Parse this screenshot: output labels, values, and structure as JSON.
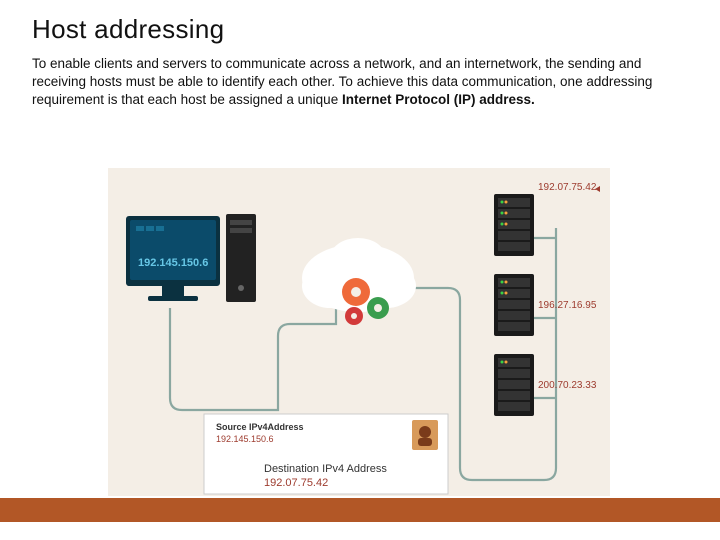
{
  "title": "Host addressing",
  "paragraph_a": "To enable clients and servers to communicate across a network, and an internetwork, the sending and receiving hosts must be able to identify each other. To achieve this data communication, one addressing requirement is that each host be assigned a unique ",
  "paragraph_b": "Internet Protocol (IP) address.",
  "diagram": {
    "client_ip": "192.145.150.6",
    "servers": [
      {
        "ip": "192.07.75.42"
      },
      {
        "ip": "196.27.16.95"
      },
      {
        "ip": "200.70.23.33"
      }
    ],
    "source_label": "Source IPv4Address",
    "source_value": "192.145.150.6",
    "dest_label": "Destination IPv4 Address",
    "dest_value": "192.07.75.42"
  }
}
